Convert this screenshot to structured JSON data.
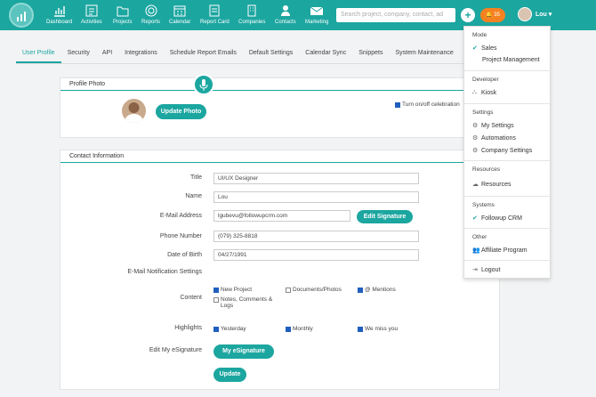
{
  "nav": {
    "items": [
      {
        "label": "Dashboard",
        "icon": "bar-chart-icon"
      },
      {
        "label": "Activities",
        "icon": "list-icon"
      },
      {
        "label": "Projects",
        "icon": "folder-icon"
      },
      {
        "label": "Reports",
        "icon": "target-icon"
      },
      {
        "label": "Calendar",
        "icon": "calendar-icon"
      },
      {
        "label": "Report Card",
        "icon": "report-card-icon"
      },
      {
        "label": "Companies",
        "icon": "building-icon"
      },
      {
        "label": "Contacts",
        "icon": "person-icon"
      },
      {
        "label": "Marketing",
        "icon": "envelope-icon"
      }
    ]
  },
  "search": {
    "placeholder": "Search project, company, contact, ad"
  },
  "header": {
    "plus": "+",
    "notif": "35",
    "user": "Lou ▾"
  },
  "tabs": [
    "User Profile",
    "Security",
    "API",
    "Integrations",
    "Schedule Report Emails",
    "Default Settings",
    "Calendar Sync",
    "Snippets",
    "System Maintenance"
  ],
  "profile": {
    "heading": "Profile Photo",
    "update_photo": "Update Photo",
    "celebration": "Turn on/off celebration"
  },
  "contact": {
    "heading": "Contact Information",
    "title_label": "Title",
    "title_value": "UI/UX Designer",
    "name_label": "Name",
    "name_value": "Lou",
    "email_label": "E-Mail Address",
    "email_value": "lgubevu@followupcrm.com",
    "edit_signature": "Edit Signature",
    "phone_label": "Phone Number",
    "phone_value": "(079) 325-8818",
    "dob_label": "Date of Birth",
    "dob_value": "04/27/1991",
    "notif_label": "E-Mail Notification Settings",
    "content_label": "Content",
    "content_opts": [
      "New Project",
      "Documents/Photos",
      "@ Mentions",
      "Notes, Comments & Logs"
    ],
    "highlights_label": "Highlights",
    "highlight_opts": [
      "Yesterday",
      "Monthly",
      "We miss you"
    ],
    "esig_label": "Edit My eSignature",
    "esig_button": "My eSignature",
    "update_button": "Update"
  },
  "menu": {
    "mode": "Mode",
    "sales": "Sales",
    "pm": "Project Management",
    "developer": "Developer",
    "kiosk": "Kiosk",
    "settings": "Settings",
    "my_settings": "My Settings",
    "automations": "Automations",
    "company_settings": "Company Settings",
    "resources_h": "Resources",
    "resources": "Resources",
    "systems": "Systems",
    "followup": "Followup CRM",
    "other": "Other",
    "affiliate": "Affiliate Program",
    "logout": "Logout"
  }
}
